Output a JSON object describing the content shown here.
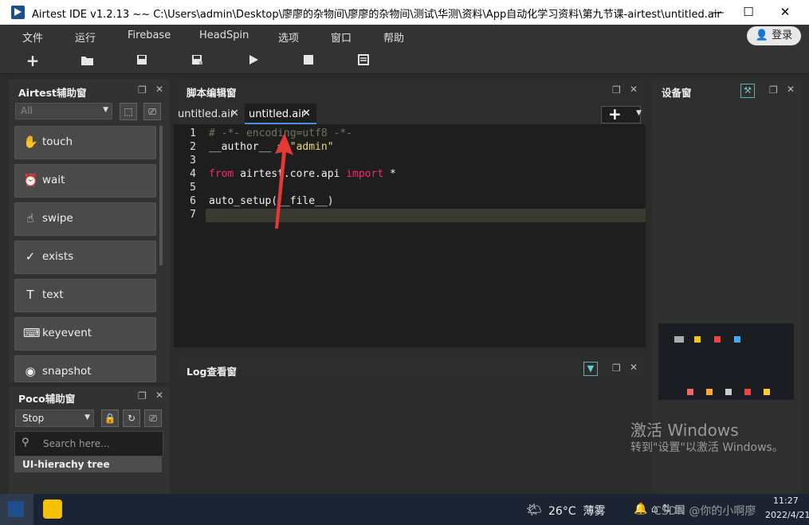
{
  "window": {
    "title": "Airtest IDE v1.2.13 ~~ C:\\Users\\admin\\Desktop\\廖廖的杂物间\\廖廖的杂物间\\测试\\华测\\资料\\App自动化学习资料\\第九节课-airtest\\untitled.air",
    "minimize": "—",
    "maximize": "☐",
    "close": "✕"
  },
  "menu": [
    "文件",
    "运行",
    "Firebase",
    "HeadSpin",
    "选项",
    "窗口",
    "帮助"
  ],
  "login_label": "登录",
  "toolbar": {
    "new_icon": "plus-icon",
    "open_icon": "folder-icon",
    "save_icon": "save-icon",
    "saveas_icon": "save-as-icon",
    "run_icon": "play-icon",
    "stop_icon": "stop-icon",
    "log_icon": "report-icon"
  },
  "airtest_panel": {
    "title": "Airtest辅助窗",
    "filter_value": "All",
    "commands": [
      {
        "label": "touch",
        "icon": "✋"
      },
      {
        "label": "wait",
        "icon": "⏰"
      },
      {
        "label": "swipe",
        "icon": "☝"
      },
      {
        "label": "exists",
        "icon": "✓"
      },
      {
        "label": "text",
        "icon": "T"
      },
      {
        "label": "keyevent",
        "icon": "⌨"
      },
      {
        "label": "snapshot",
        "icon": "◉"
      }
    ]
  },
  "poco_panel": {
    "title": "Poco辅助窗",
    "mode_value": "Stop",
    "search_placeholder": "Search here...",
    "tree_label": "UI-hierachy tree"
  },
  "editor": {
    "title": "脚本编辑窗",
    "tabs": [
      {
        "label": "untitled.air",
        "active": false
      },
      {
        "label": "untitled.air",
        "active": true
      }
    ],
    "lines": [
      {
        "n": "1",
        "parts": [
          {
            "t": "# -*- encoding=utf8 -*-",
            "c": "#75715e"
          }
        ]
      },
      {
        "n": "2",
        "parts": [
          {
            "t": "__author__ = ",
            "c": "#f0f0f0"
          },
          {
            "t": "\"admin\"",
            "c": "#e6db74"
          }
        ]
      },
      {
        "n": "3",
        "parts": []
      },
      {
        "n": "4",
        "parts": [
          {
            "t": "from",
            "c": "#f92672"
          },
          {
            "t": " airtest.core.api ",
            "c": "#f0f0f0"
          },
          {
            "t": "import",
            "c": "#f92672"
          },
          {
            "t": " *",
            "c": "#f0f0f0"
          }
        ]
      },
      {
        "n": "5",
        "parts": []
      },
      {
        "n": "6",
        "parts": [
          {
            "t": "auto_setup(__file__)",
            "c": "#f0f0f0"
          }
        ]
      },
      {
        "n": "7",
        "parts": []
      }
    ]
  },
  "log_panel": {
    "title": "Log查看窗"
  },
  "device_panel": {
    "title": "设备窗"
  },
  "watermark": {
    "line1": "激活 Windows",
    "line2": "转到\"设置\"以激活 Windows。"
  },
  "taskbar": {
    "weather": "26°C  薄雾",
    "time": "11:27",
    "date": "2022/4/21",
    "csdn": "CSDN @你的小啊廖"
  },
  "colors": {
    "accent": "#1f4e8c",
    "arrow": "#e53935",
    "current_line": "#3a3a33"
  }
}
